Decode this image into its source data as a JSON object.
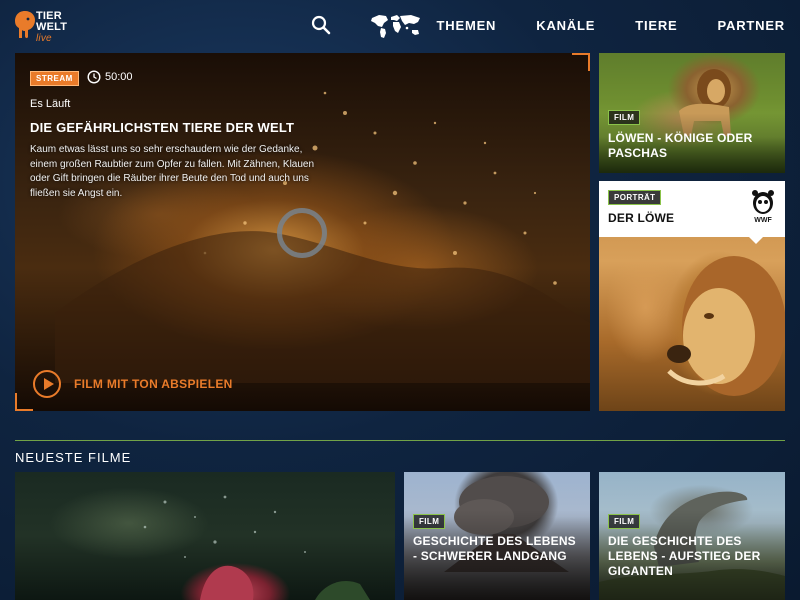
{
  "brand": {
    "logo_line1": "TIER",
    "logo_line2": "WELT",
    "logo_line3": "live",
    "accent_color": "#e97b2a",
    "secondary_accent": "#8bc34a"
  },
  "header": {
    "search_icon": "search-icon",
    "map_icon": "world-map-icon",
    "nav": [
      {
        "label": "THEMEN"
      },
      {
        "label": "KANÄLE"
      },
      {
        "label": "TIERE"
      },
      {
        "label": "PARTNER"
      }
    ]
  },
  "hero": {
    "badge": "STREAM",
    "duration": "50:00",
    "status": "Es Läuft",
    "title": "DIE GEFÄHRLICHSTEN TIERE DER WELT",
    "description": "Kaum etwas lässt uns so sehr erschaudern wie der Gedanke, einem großen Raubtier zum Opfer zu fallen. Mit Zähnen, Klauen oder Gift bringen die Räuber ihrer Beute den Tod und auch uns fließen sie Angst ein.",
    "play_label": "FILM MIT TON ABSPIELEN"
  },
  "side_cards": [
    {
      "badge": "FILM",
      "title": "LÖWEN - KÖNIGE ODER PASCHAS"
    },
    {
      "badge": "PORTRÄT",
      "title": "DER LÖWE",
      "partner": "WWF"
    }
  ],
  "section": {
    "title": "NEUESTE FILME"
  },
  "tiles": [
    {
      "badge": "",
      "title": ""
    },
    {
      "badge": "FILM",
      "title": "GESCHICHTE DES LEBENS - SCHWERER LANDGANG"
    },
    {
      "badge": "FILM",
      "title": "DIE GESCHICHTE DES LEBENS - AUFSTIEG DER GIGANTEN"
    }
  ]
}
